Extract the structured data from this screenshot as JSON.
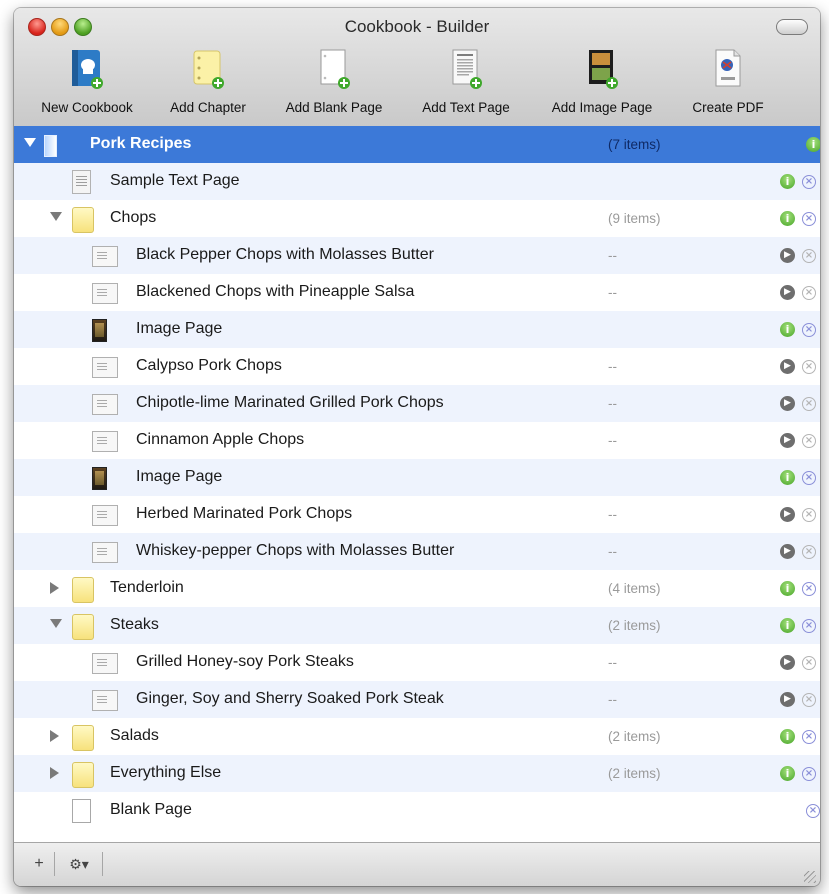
{
  "window": {
    "title": "Cookbook - Builder"
  },
  "toolbar": [
    {
      "key": "new-cookbook",
      "label": "New Cookbook",
      "icon": "cookbook-icon"
    },
    {
      "key": "add-chapter",
      "label": "Add Chapter",
      "icon": "chapter-icon"
    },
    {
      "key": "add-blank-page",
      "label": "Add Blank Page",
      "icon": "blank-page-icon"
    },
    {
      "key": "add-text-page",
      "label": "Add Text Page",
      "icon": "text-page-icon"
    },
    {
      "key": "add-image-page",
      "label": "Add Image Page",
      "icon": "image-page-icon"
    },
    {
      "key": "create-pdf",
      "label": "Create PDF",
      "icon": "pdf-icon"
    }
  ],
  "tree": {
    "rows": [
      {
        "label": "Pork Recipes",
        "count": "(7 items)",
        "kind": "book",
        "disclosure": "open",
        "level": 0,
        "selected": true,
        "actions": [
          "info"
        ]
      },
      {
        "label": "Sample Text Page",
        "count": "",
        "kind": "text",
        "disclosure": "none",
        "level": 1,
        "actions": [
          "info",
          "delete"
        ]
      },
      {
        "label": "Chops",
        "count": "(9 items)",
        "kind": "chapter",
        "disclosure": "open",
        "level": 1,
        "actions": [
          "info",
          "delete"
        ]
      },
      {
        "label": "Black Pepper Chops with Molasses Butter",
        "count": "--",
        "kind": "recipe",
        "disclosure": "none",
        "level": 2,
        "actions": [
          "arrow",
          "delete-gray"
        ]
      },
      {
        "label": "Blackened Chops with Pineapple Salsa",
        "count": "--",
        "kind": "recipe",
        "disclosure": "none",
        "level": 2,
        "actions": [
          "arrow",
          "delete-gray"
        ]
      },
      {
        "label": "Image Page",
        "count": "",
        "kind": "image",
        "disclosure": "none",
        "level": 2,
        "actions": [
          "info",
          "delete"
        ]
      },
      {
        "label": "Calypso Pork Chops",
        "count": "--",
        "kind": "recipe",
        "disclosure": "none",
        "level": 2,
        "actions": [
          "arrow",
          "delete-gray"
        ]
      },
      {
        "label": "Chipotle-lime Marinated Grilled Pork Chops",
        "count": "--",
        "kind": "recipe",
        "disclosure": "none",
        "level": 2,
        "actions": [
          "arrow",
          "delete-gray"
        ]
      },
      {
        "label": "Cinnamon Apple Chops",
        "count": "--",
        "kind": "recipe",
        "disclosure": "none",
        "level": 2,
        "actions": [
          "arrow",
          "delete-gray"
        ]
      },
      {
        "label": "Image Page",
        "count": "",
        "kind": "image",
        "disclosure": "none",
        "level": 2,
        "actions": [
          "info",
          "delete"
        ]
      },
      {
        "label": "Herbed Marinated Pork Chops",
        "count": "--",
        "kind": "recipe",
        "disclosure": "none",
        "level": 2,
        "actions": [
          "arrow",
          "delete-gray"
        ]
      },
      {
        "label": "Whiskey-pepper Chops with Molasses Butter",
        "count": "--",
        "kind": "recipe",
        "disclosure": "none",
        "level": 2,
        "actions": [
          "arrow",
          "delete-gray"
        ]
      },
      {
        "label": "Tenderloin",
        "count": "(4 items)",
        "kind": "chapter",
        "disclosure": "closed",
        "level": 1,
        "actions": [
          "info",
          "delete"
        ]
      },
      {
        "label": "Steaks",
        "count": "(2 items)",
        "kind": "chapter",
        "disclosure": "open",
        "level": 1,
        "actions": [
          "info",
          "delete"
        ]
      },
      {
        "label": "Grilled Honey-soy Pork Steaks",
        "count": "--",
        "kind": "recipe",
        "disclosure": "none",
        "level": 2,
        "actions": [
          "arrow",
          "delete-gray"
        ]
      },
      {
        "label": "Ginger, Soy and Sherry Soaked Pork Steak",
        "count": "--",
        "kind": "recipe",
        "disclosure": "none",
        "level": 2,
        "actions": [
          "arrow",
          "delete-gray"
        ]
      },
      {
        "label": "Salads",
        "count": "(2 items)",
        "kind": "chapter",
        "disclosure": "closed",
        "level": 1,
        "actions": [
          "info",
          "delete"
        ]
      },
      {
        "label": "Everything Else",
        "count": "(2 items)",
        "kind": "chapter",
        "disclosure": "closed",
        "level": 1,
        "actions": [
          "info",
          "delete"
        ]
      },
      {
        "label": "Blank Page",
        "count": "",
        "kind": "blank",
        "disclosure": "none",
        "level": 1,
        "actions": [
          "delete"
        ]
      }
    ]
  },
  "bottom_bar": {
    "add_label": "+",
    "gear_label": "⚙▾"
  },
  "colors": {
    "selection": "#3c79d8",
    "alt_row": "#eef3fd",
    "info_green": "#47a528"
  }
}
